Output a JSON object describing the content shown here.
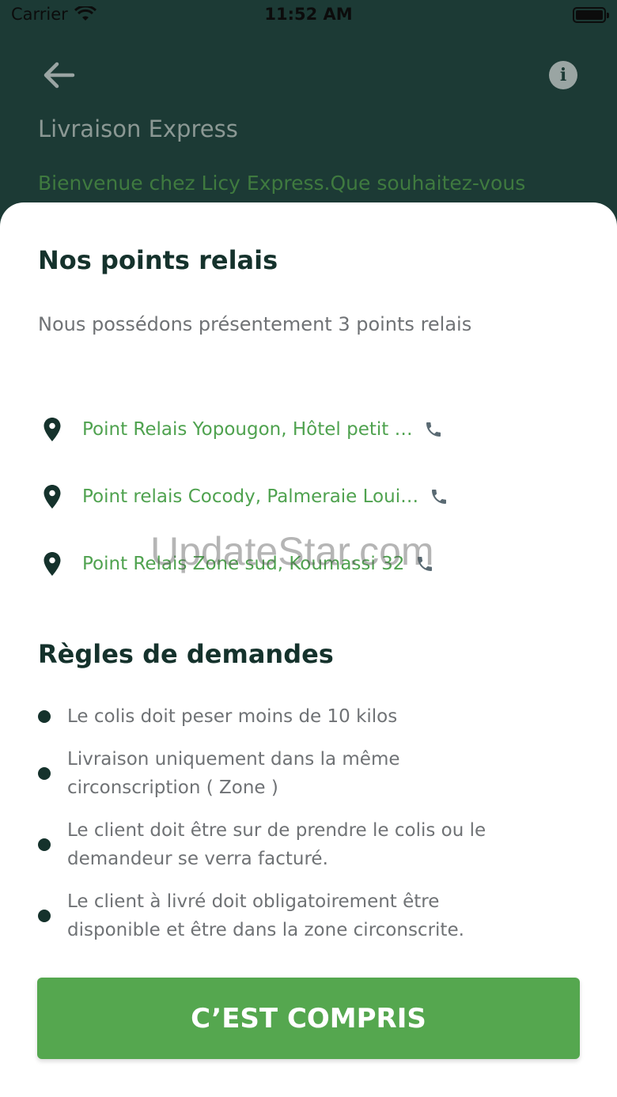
{
  "status_bar": {
    "carrier": "Carrier",
    "time": "11:52 AM"
  },
  "header": {
    "title": "Livraison Express",
    "welcome": "Bienvenue chez Licy Express.Que souhaitez-vous"
  },
  "relay_section": {
    "title": "Nos points relais",
    "subtitle": "Nous possédons présentement 3 points relais",
    "items": [
      {
        "label": "Point Relais Yopougon, Hôtel petit …"
      },
      {
        "label": "Point relais Cocody, Palmeraie Loui…"
      },
      {
        "label": "Point Relais Zone sud, Koumassi 32"
      }
    ]
  },
  "rules_section": {
    "title": "Règles de demandes",
    "items": [
      {
        "text": "Le colis doit peser moins de 10 kilos"
      },
      {
        "text": "Livraison uniquement dans la même circonscription ( Zone )"
      },
      {
        "text": "Le client doit être sur de prendre le colis ou le demandeur se verra facturé."
      },
      {
        "text": "Le client à livré doit obligatoirement être disponible et être dans la zone circonscrite."
      }
    ]
  },
  "confirm_button": {
    "label": "C’EST COMPRIS"
  },
  "watermark": "UpdateStar.com",
  "icons": {
    "back": "arrow-left-icon",
    "info": "info-icon",
    "pin": "map-pin-icon",
    "phone": "phone-icon",
    "wifi": "wifi-icon",
    "battery": "battery-icon"
  },
  "colors": {
    "header_bg": "#1c3a35",
    "accent_green": "#55a74f",
    "relay_text": "#4fa24f",
    "title_text": "#15322c",
    "body_text": "#6f7275"
  }
}
